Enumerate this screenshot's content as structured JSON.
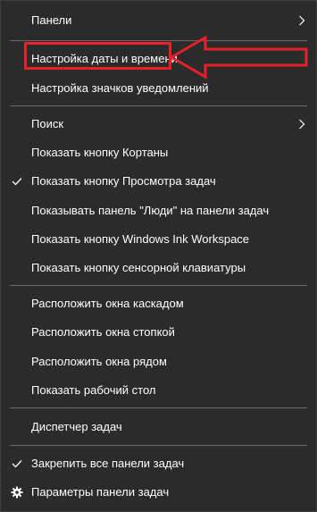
{
  "menu": {
    "items": [
      {
        "label": "Панели",
        "has_submenu": true
      },
      {
        "label": "Настройка даты и времени"
      },
      {
        "label": "Настройка значков уведомлений"
      },
      {
        "label": "Поиск",
        "has_submenu": true
      },
      {
        "label": "Показать кнопку Кортаны"
      },
      {
        "label": "Показать кнопку Просмотра задач",
        "checked": true
      },
      {
        "label": "Показывать панель \"Люди\" на панели задач"
      },
      {
        "label": "Показать кнопку Windows Ink Workspace"
      },
      {
        "label": "Показать кнопку сенсорной клавиатуры"
      },
      {
        "label": "Расположить окна каскадом"
      },
      {
        "label": "Расположить окна стопкой"
      },
      {
        "label": "Расположить окна рядом"
      },
      {
        "label": "Показать рабочий стол"
      },
      {
        "label": "Диспетчер задач"
      },
      {
        "label": "Закрепить все панели задач",
        "checked": true
      },
      {
        "label": "Параметры панели задач",
        "icon": "gear-icon"
      }
    ]
  },
  "colors": {
    "menu_background": "#2b2b2b",
    "text": "#ffffff",
    "separator": "#6a6a6a",
    "annotation": "#e8202a"
  }
}
